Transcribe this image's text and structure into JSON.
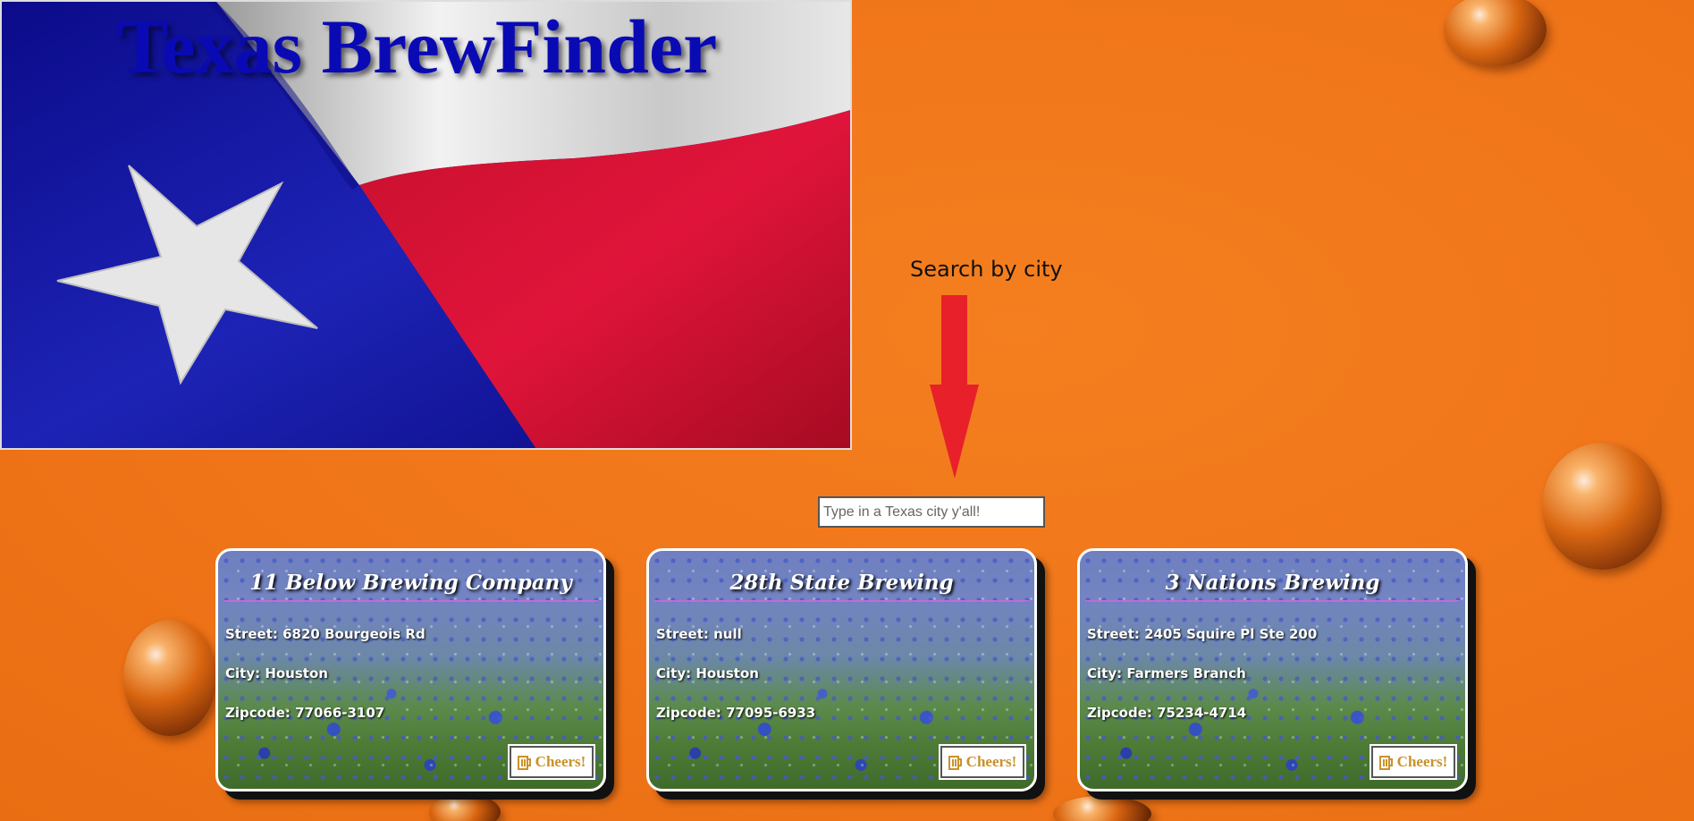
{
  "header": {
    "title": "Texas BrewFinder"
  },
  "search": {
    "label": "Search by city",
    "placeholder": "Type in a Texas city y'all!",
    "value": ""
  },
  "icons": {
    "arrow": "down-arrow-icon",
    "beer": "beer-mug-icon"
  },
  "colors": {
    "background": "#f07519",
    "title": "#0a0ab5",
    "arrow": "#e8202a",
    "button_text": "#c9922a"
  },
  "breweries": [
    {
      "name": "11 Below Brewing Company",
      "street": "Street: 6820 Bourgeois Rd",
      "city": "City: Houston",
      "zipcode": "Zipcode: 77066-3107",
      "button": "Cheers!"
    },
    {
      "name": "28th State Brewing",
      "street": "Street: null",
      "city": "City: Houston",
      "zipcode": "Zipcode: 77095-6933",
      "button": "Cheers!"
    },
    {
      "name": "3 Nations Brewing",
      "street": "Street: 2405 Squire Pl Ste 200",
      "city": "City: Farmers Branch",
      "zipcode": "Zipcode: 75234-4714",
      "button": "Cheers!"
    }
  ]
}
